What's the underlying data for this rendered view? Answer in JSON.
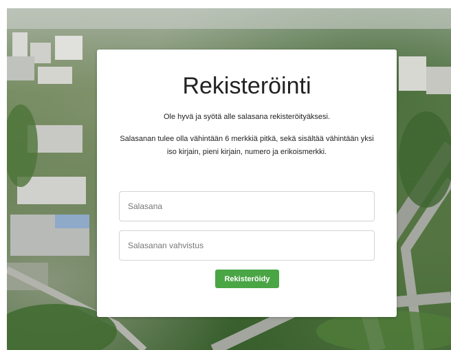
{
  "colors": {
    "card_background": "#ffffff",
    "button_background": "#4aa545",
    "button_text": "#ffffff",
    "input_border": "#d4d4d4"
  },
  "background": {
    "icon": "aerial-city-photo"
  },
  "form": {
    "title": "Rekisteröinti",
    "intro": "Ole hyvä ja syötä alle salasana rekisteröityäksesi.",
    "requirements": "Salasanan tulee olla vähintään 6 merkkiä pitkä, sekä sisältää vähintään yksi iso kirjain, pieni kirjain, numero ja erikoismerkki.",
    "password_field": {
      "placeholder": "Salasana",
      "value": ""
    },
    "confirm_field": {
      "placeholder": "Salasanan vahvistus",
      "value": ""
    },
    "submit_label": "Rekisteröidy"
  }
}
